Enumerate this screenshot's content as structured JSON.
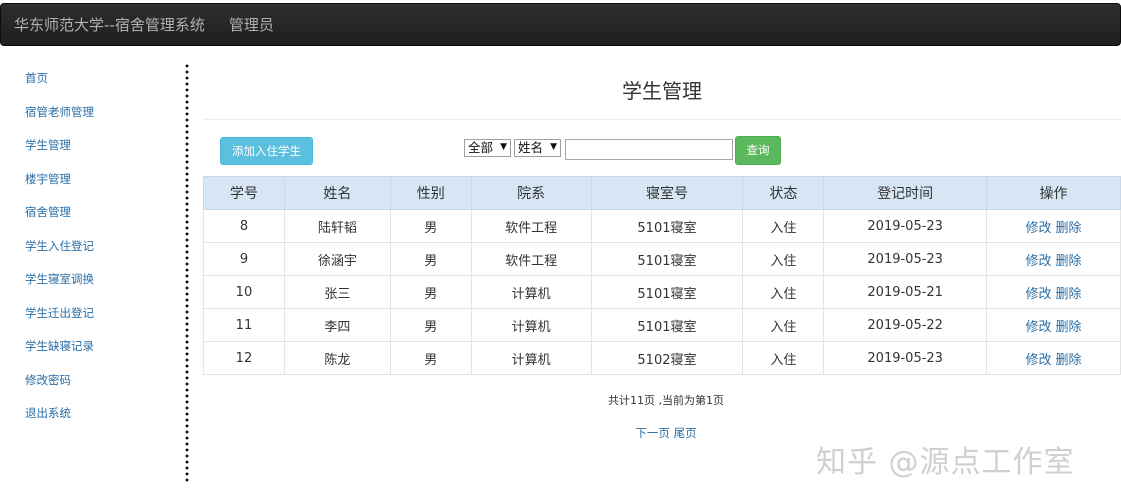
{
  "navbar": {
    "brand": "华东师范大学--宿舍管理系统",
    "role": "管理员"
  },
  "sidebar": {
    "items": [
      {
        "label": "首页"
      },
      {
        "label": "宿管老师管理"
      },
      {
        "label": "学生管理"
      },
      {
        "label": "楼宇管理"
      },
      {
        "label": "宿舍管理"
      },
      {
        "label": "学生入住登记"
      },
      {
        "label": "学生寝室调换"
      },
      {
        "label": "学生迁出登记"
      },
      {
        "label": "学生缺寝记录"
      },
      {
        "label": "修改密码"
      },
      {
        "label": "退出系统"
      }
    ]
  },
  "main": {
    "title": "学生管理"
  },
  "toolbar": {
    "add_label": "添加入住学生",
    "filter_scope": "全部",
    "filter_field": "姓名",
    "search_value": "",
    "search_label": "查询"
  },
  "table": {
    "headers": [
      "学号",
      "姓名",
      "性别",
      "院系",
      "寝室号",
      "状态",
      "登记时间",
      "操作"
    ],
    "rows": [
      {
        "id": "8",
        "name": "陆轩韬",
        "gender": "男",
        "dept": "软件工程",
        "room": "5101寝室",
        "status": "入住",
        "date": "2019-05-23",
        "edit": "修改",
        "delete": "删除"
      },
      {
        "id": "9",
        "name": "徐涵宇",
        "gender": "男",
        "dept": "软件工程",
        "room": "5101寝室",
        "status": "入住",
        "date": "2019-05-23",
        "edit": "修改",
        "delete": "删除"
      },
      {
        "id": "10",
        "name": "张三",
        "gender": "男",
        "dept": "计算机",
        "room": "5101寝室",
        "status": "入住",
        "date": "2019-05-21",
        "edit": "修改",
        "delete": "删除"
      },
      {
        "id": "11",
        "name": "李四",
        "gender": "男",
        "dept": "计算机",
        "room": "5101寝室",
        "status": "入住",
        "date": "2019-05-22",
        "edit": "修改",
        "delete": "删除"
      },
      {
        "id": "12",
        "name": "陈龙",
        "gender": "男",
        "dept": "计算机",
        "room": "5102寝室",
        "status": "入住",
        "date": "2019-05-23",
        "edit": "修改",
        "delete": "删除"
      }
    ]
  },
  "pager": {
    "info": "共计11页 ,当前为第1页",
    "next": "下一页",
    "last": "尾页"
  },
  "watermark": "知乎 @源点工作室"
}
